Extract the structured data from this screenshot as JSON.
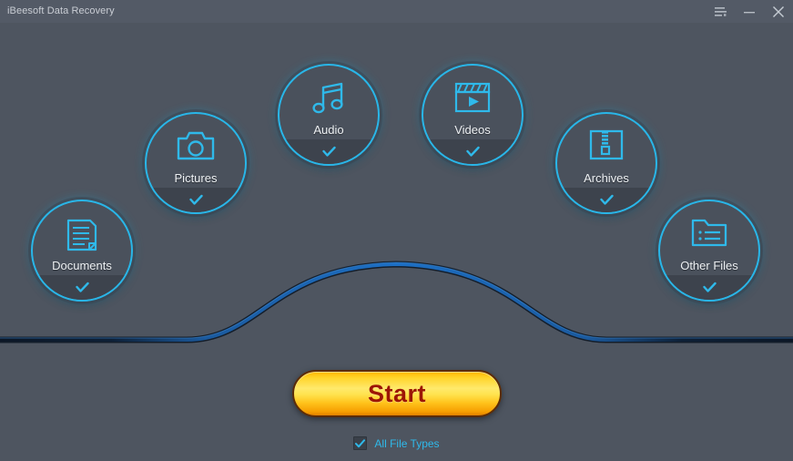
{
  "window": {
    "title": "iBeesoft Data Recovery",
    "controls": [
      {
        "name": "menu-button",
        "icon": "hamburger-menu-icon",
        "label": "Menu"
      },
      {
        "name": "minimize-button",
        "icon": "minimize-icon",
        "label": "Minimize"
      },
      {
        "name": "close-button",
        "icon": "close-icon",
        "label": "Close"
      }
    ]
  },
  "theme": {
    "background": "#4e5560",
    "titlebar": "#535a66",
    "accent_cyan": "#29b6e8",
    "circle_fill": "#4a515c",
    "circle_footer": "#3d434d",
    "wave_blue": "#1565c0",
    "wave_dark": "#0d1b2e",
    "start_text": "#9c1606",
    "start_yellow": "#ffe34f",
    "label_text": "#eef1f4"
  },
  "categories": [
    {
      "id": "documents",
      "label": "Documents",
      "icon": "document-icon",
      "checked": true
    },
    {
      "id": "pictures",
      "label": "Pictures",
      "icon": "camera-icon",
      "checked": true
    },
    {
      "id": "audio",
      "label": "Audio",
      "icon": "music-note-icon",
      "checked": true
    },
    {
      "id": "videos",
      "label": "Videos",
      "icon": "clapperboard-icon",
      "checked": true
    },
    {
      "id": "archives",
      "label": "Archives",
      "icon": "zip-archive-icon",
      "checked": true
    },
    {
      "id": "other",
      "label": "Other Files",
      "icon": "folder-list-icon",
      "checked": true
    }
  ],
  "actions": {
    "start_label": "Start"
  },
  "footer": {
    "all_file_types_label": "All File Types",
    "all_file_types_checked": true
  }
}
